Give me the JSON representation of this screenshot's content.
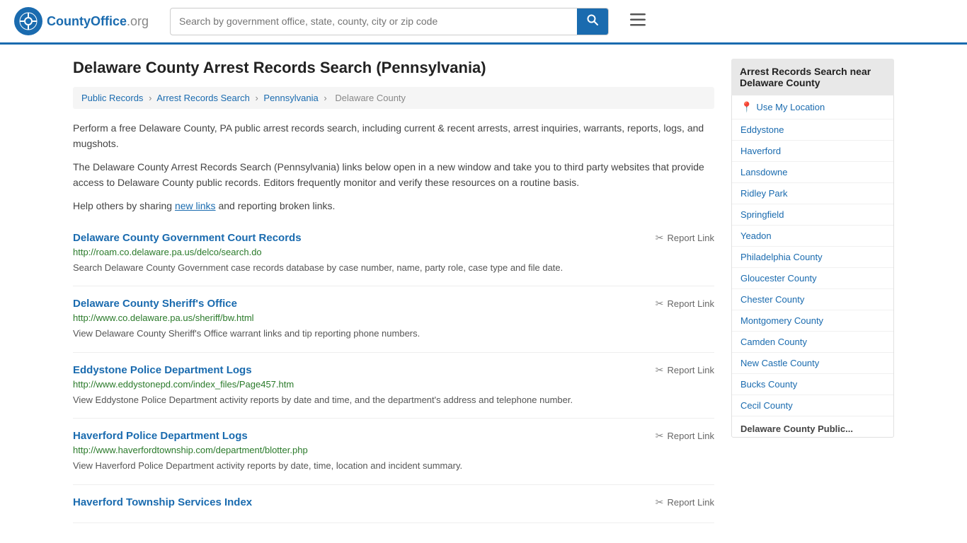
{
  "header": {
    "logo_text": "CountyOffice",
    "logo_suffix": ".org",
    "search_placeholder": "Search by government office, state, county, city or zip code"
  },
  "page": {
    "title": "Delaware County Arrest Records Search (Pennsylvania)",
    "breadcrumb": {
      "items": [
        "Public Records",
        "Arrest Records Search",
        "Pennsylvania",
        "Delaware County"
      ]
    },
    "description1": "Perform a free Delaware County, PA public arrest records search, including current & recent arrests, arrest inquiries, warrants, reports, logs, and mugshots.",
    "description2": "The Delaware County Arrest Records Search (Pennsylvania) links below open in a new window and take you to third party websites that provide access to Delaware County public records. Editors frequently monitor and verify these resources on a routine basis.",
    "description3_prefix": "Help others by sharing ",
    "new_links_label": "new links",
    "description3_suffix": " and reporting broken links."
  },
  "results": [
    {
      "title": "Delaware County Government Court Records",
      "url": "http://roam.co.delaware.pa.us/delco/search.do",
      "desc": "Search Delaware County Government case records database by case number, name, party role, case type and file date.",
      "report_label": "Report Link"
    },
    {
      "title": "Delaware County Sheriff's Office",
      "url": "http://www.co.delaware.pa.us/sheriff/bw.html",
      "desc": "View Delaware County Sheriff's Office warrant links and tip reporting phone numbers.",
      "report_label": "Report Link"
    },
    {
      "title": "Eddystone Police Department Logs",
      "url": "http://www.eddystonepd.com/index_files/Page457.htm",
      "desc": "View Eddystone Police Department activity reports by date and time, and the department's address and telephone number.",
      "report_label": "Report Link"
    },
    {
      "title": "Haverford Police Department Logs",
      "url": "http://www.haverfordtownship.com/department/blotter.php",
      "desc": "View Haverford Police Department activity reports by date, time, location and incident summary.",
      "report_label": "Report Link"
    },
    {
      "title": "Haverford Township Services Index",
      "url": "",
      "desc": "",
      "report_label": "Report Link"
    }
  ],
  "sidebar": {
    "header": "Arrest Records Search near Delaware County",
    "use_my_location": "Use My Location",
    "links": [
      "Eddystone",
      "Haverford",
      "Lansdowne",
      "Ridley Park",
      "Springfield",
      "Yeadon",
      "Philadelphia County",
      "Gloucester County",
      "Chester County",
      "Montgomery County",
      "Camden County",
      "New Castle County",
      "Bucks County",
      "Cecil County"
    ],
    "bottom_label": "Delaware County Public..."
  }
}
